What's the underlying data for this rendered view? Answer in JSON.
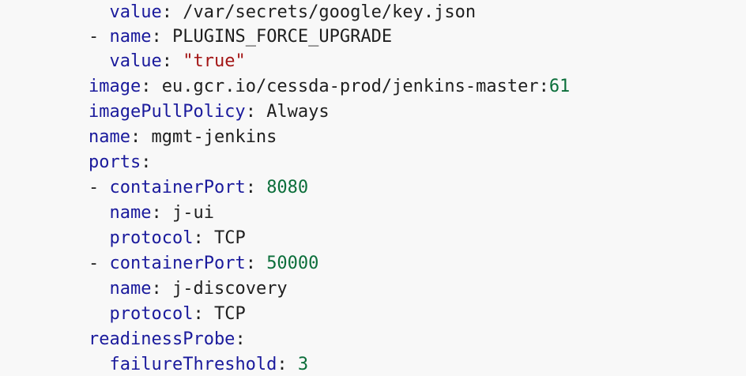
{
  "colors": {
    "background": "#f8f8f8",
    "key": "#1a1a9c",
    "plain": "#1f1f1f",
    "string": "#a31515",
    "number": "#0b6e3a"
  },
  "lines": [
    {
      "key": "value",
      "value": "/var/secrets/google/key.json"
    },
    {
      "dash": "- ",
      "key": "name",
      "value": "PLUGINS_FORCE_UPGRADE"
    },
    {
      "key": "value",
      "value": "\"true\""
    },
    {
      "key": "image",
      "value": "eu.gcr.io/cessda-prod/jenkins-master",
      "value_colon": ":",
      "value_num": "61"
    },
    {
      "key": "imagePullPolicy",
      "value": "Always"
    },
    {
      "key": "name",
      "value": "mgmt-jenkins"
    },
    {
      "key": "ports"
    },
    {
      "dash": "- ",
      "key": "containerPort",
      "value": "8080"
    },
    {
      "key": "name",
      "value": "j-ui"
    },
    {
      "key": "protocol",
      "value": "TCP"
    },
    {
      "dash": "- ",
      "key": "containerPort",
      "value": "50000"
    },
    {
      "key": "name",
      "value": "j-discovery"
    },
    {
      "key": "protocol",
      "value": "TCP"
    },
    {
      "key": "readinessProbe"
    },
    {
      "key": "failureThreshold",
      "value": "3"
    }
  ]
}
